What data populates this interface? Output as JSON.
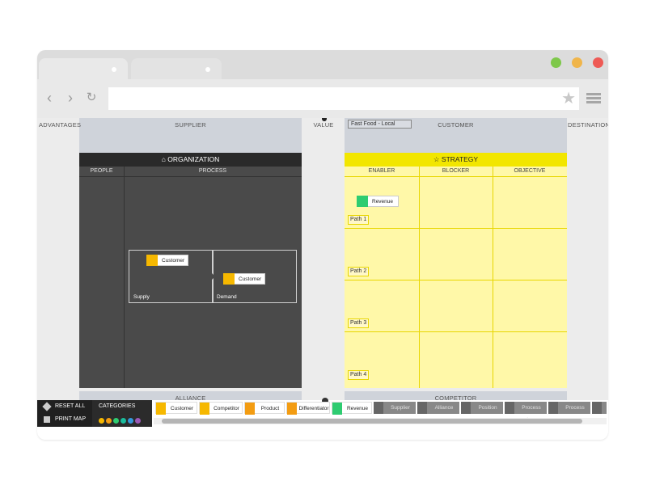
{
  "header": {
    "advantages": "ADVANTAGES",
    "supplier": "SUPPLIER",
    "value": "VALUE",
    "customer": "CUSTOMER",
    "destination": "DESTINATION",
    "search_value": "Fast Food - Local",
    "alliance": "ALLIANCE",
    "competitor": "COMPETITOR"
  },
  "organization": {
    "title": "ORGANIZATION",
    "col_people": "PEOPLE",
    "col_process": "PROCESS",
    "card_customer_1": "Customer",
    "card_customer_2": "Customer",
    "supply_label": "Supply",
    "demand_label": "Demand"
  },
  "strategy": {
    "title": "STRATEGY",
    "col_enabler": "ENABLER",
    "col_blocker": "BLOCKER",
    "col_objective": "OBJECTIVE",
    "card_revenue": "Revenue",
    "paths": [
      "Path 1",
      "Path 2",
      "Path 3",
      "Path 4"
    ]
  },
  "bottom": {
    "reset_all": "RESET ALL",
    "print_map": "PRINT MAP",
    "categories_label": "CATEGORIES",
    "category_colors": [
      "#f6b800",
      "#f39c12",
      "#2ecc71",
      "#1abc9c",
      "#3498db",
      "#9b59b6"
    ],
    "chips": [
      "Customer",
      "Competitor",
      "Product",
      "Differentiator",
      "Revenue",
      "Supplier",
      "Alliance",
      "Position",
      "Process Area",
      "Process"
    ]
  },
  "window": {
    "colors": {
      "green": "#7ec84a",
      "yellow": "#f0b54a",
      "red": "#ee5a55"
    }
  }
}
